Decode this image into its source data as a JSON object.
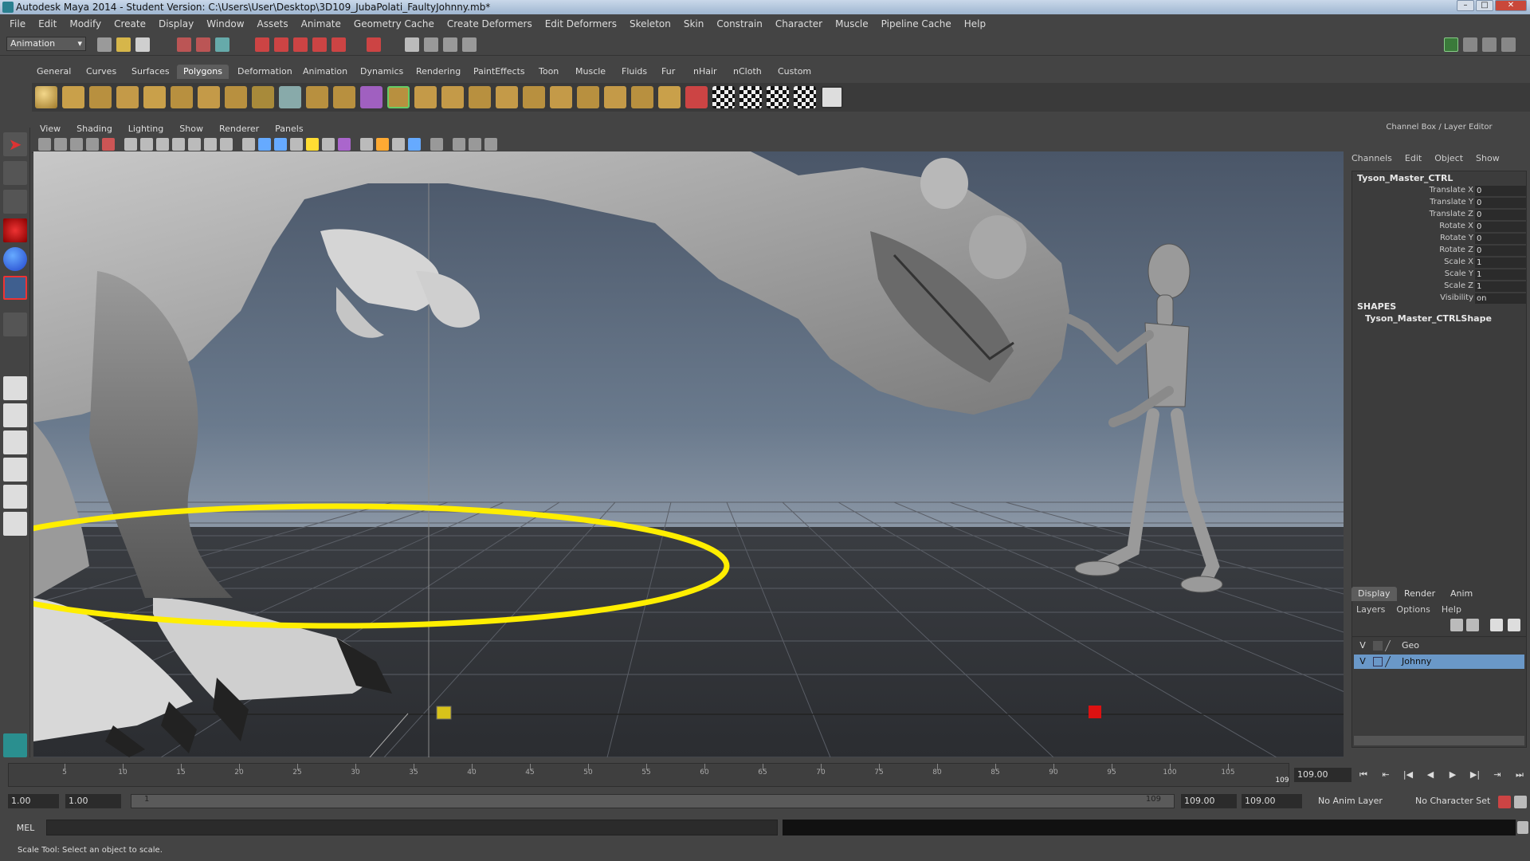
{
  "window": {
    "title": "Autodesk Maya 2014 - Student Version: C:\\Users\\User\\Desktop\\3D109_JubaPolati_FaultyJohnny.mb*"
  },
  "menubar": [
    "File",
    "Edit",
    "Modify",
    "Create",
    "Display",
    "Window",
    "Assets",
    "Animate",
    "Geometry Cache",
    "Create Deformers",
    "Edit Deformers",
    "Skeleton",
    "Skin",
    "Constrain",
    "Character",
    "Muscle",
    "Pipeline Cache",
    "Help"
  ],
  "status_line": {
    "mode": "Animation"
  },
  "shelf": {
    "tabs": [
      "General",
      "Curves",
      "Surfaces",
      "Polygons",
      "Deformation",
      "Animation",
      "Dynamics",
      "Rendering",
      "PaintEffects",
      "Toon",
      "Muscle",
      "Fluids",
      "Fur",
      "nHair",
      "nCloth",
      "Custom"
    ],
    "active_tab": "Polygons"
  },
  "panel_menu": [
    "View",
    "Shading",
    "Lighting",
    "Show",
    "Renderer",
    "Panels"
  ],
  "channel_box": {
    "title": "Channel Box / Layer Editor",
    "menu": [
      "Channels",
      "Edit",
      "Object",
      "Show"
    ],
    "object": "Tyson_Master_CTRL",
    "channels": [
      {
        "label": "Translate X",
        "value": "0"
      },
      {
        "label": "Translate Y",
        "value": "0"
      },
      {
        "label": "Translate Z",
        "value": "0"
      },
      {
        "label": "Rotate X",
        "value": "0"
      },
      {
        "label": "Rotate Y",
        "value": "0"
      },
      {
        "label": "Rotate Z",
        "value": "0"
      },
      {
        "label": "Scale X",
        "value": "1"
      },
      {
        "label": "Scale Y",
        "value": "1"
      },
      {
        "label": "Scale Z",
        "value": "1"
      },
      {
        "label": "Visibility",
        "value": "on"
      }
    ],
    "shapes_heading": "SHAPES",
    "shape": "Tyson_Master_CTRLShape"
  },
  "layer_editor": {
    "tabs": [
      "Display",
      "Render",
      "Anim"
    ],
    "active_tab": "Display",
    "menu": [
      "Layers",
      "Options",
      "Help"
    ],
    "layers": [
      {
        "visible": "V",
        "name": "Geo",
        "selected": false
      },
      {
        "visible": "V",
        "name": "Johnny",
        "selected": true
      }
    ]
  },
  "time_slider": {
    "ticks": [
      "5",
      "10",
      "15",
      "20",
      "25",
      "30",
      "35",
      "40",
      "45",
      "50",
      "55",
      "60",
      "65",
      "70",
      "75",
      "80",
      "85",
      "90",
      "95",
      "100",
      "105"
    ],
    "end_label": "109",
    "current_frame": "109.00"
  },
  "range_slider": {
    "start_time": "1.00",
    "playback_start": "1.00",
    "range_start": "1",
    "range_end": "109",
    "playback_end": "109.00",
    "end_time": "109.00",
    "anim_layer": "No Anim Layer",
    "character_set": "No Character Set"
  },
  "command_line": {
    "label": "MEL"
  },
  "help_line": {
    "text": "Scale Tool: Select an object to scale."
  },
  "colors": {
    "selection": "#6a98c8",
    "manip_ring": "#ffee00",
    "bg": "#444444"
  }
}
